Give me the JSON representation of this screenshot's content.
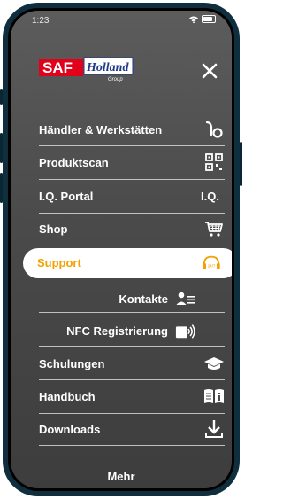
{
  "status_bar": {
    "time": "1:23"
  },
  "brand": {
    "name": "SAF Holland",
    "sub": "Group"
  },
  "menu": {
    "items": [
      {
        "label": "Händler & Werkstätten",
        "icon": "dealer-map-pin-icon"
      },
      {
        "label": "Produktscan",
        "icon": "qr-code-icon"
      },
      {
        "label": "I.Q. Portal",
        "icon": "iq-logo-icon"
      },
      {
        "label": "Shop",
        "icon": "shopping-cart-icon"
      }
    ],
    "support": {
      "label": "Support",
      "icon": "support-headset-icon",
      "badge": "24/7"
    },
    "subitems": [
      {
        "label": "Kontakte",
        "icon": "contacts-icon"
      },
      {
        "label": "NFC Registrierung",
        "icon": "nfc-icon"
      }
    ],
    "items2": [
      {
        "label": "Schulungen",
        "icon": "graduation-cap-icon"
      },
      {
        "label": "Handbuch",
        "icon": "manual-book-icon"
      },
      {
        "label": "Downloads",
        "icon": "download-icon"
      }
    ],
    "more_label": "Mehr"
  },
  "colors": {
    "accent": "#f3a100",
    "brand_red": "#e3001b",
    "brand_blue": "#1e3a8a"
  }
}
